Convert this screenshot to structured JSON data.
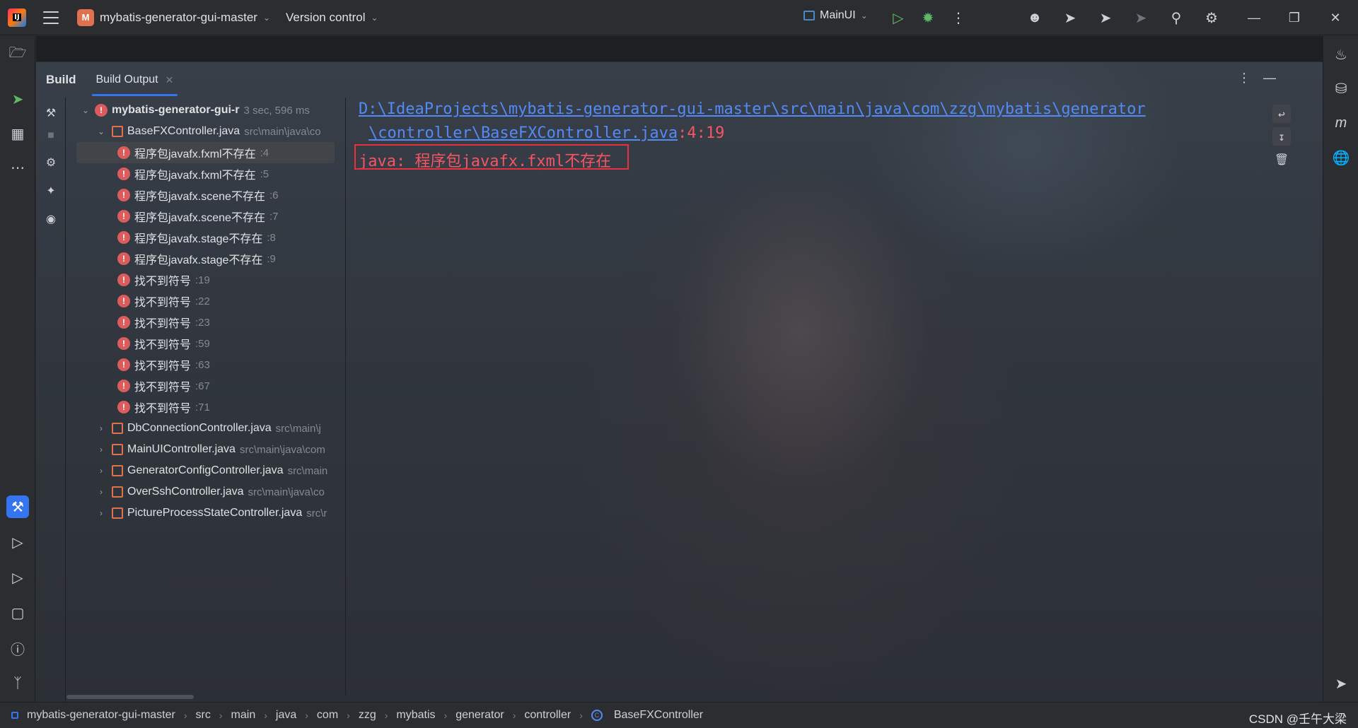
{
  "titlebar": {
    "project_badge": "M",
    "project_name": "mybatis-generator-gui-master",
    "version_control": "Version control",
    "run_config": "MainUI"
  },
  "build_window": {
    "title": "Build",
    "tab_label": "Build Output"
  },
  "tree": {
    "root": {
      "label": "mybatis-generator-gui-r",
      "meta": "3 sec, 596 ms"
    },
    "expanded_file": {
      "label": "BaseFXController.java",
      "path": "src\\main\\java\\co"
    },
    "errors": [
      {
        "label": "程序包javafx.fxml不存在",
        "line": ":4"
      },
      {
        "label": "程序包javafx.fxml不存在",
        "line": ":5"
      },
      {
        "label": "程序包javafx.scene不存在",
        "line": ":6"
      },
      {
        "label": "程序包javafx.scene不存在",
        "line": ":7"
      },
      {
        "label": "程序包javafx.stage不存在",
        "line": ":8"
      },
      {
        "label": "程序包javafx.stage不存在",
        "line": ":9"
      },
      {
        "label": "找不到符号",
        "line": ":19"
      },
      {
        "label": "找不到符号",
        "line": ":22"
      },
      {
        "label": "找不到符号",
        "line": ":23"
      },
      {
        "label": "找不到符号",
        "line": ":59"
      },
      {
        "label": "找不到符号",
        "line": ":63"
      },
      {
        "label": "找不到符号",
        "line": ":67"
      },
      {
        "label": "找不到符号",
        "line": ":71"
      }
    ],
    "collapsed_files": [
      {
        "label": "DbConnectionController.java",
        "path": "src\\main\\j"
      },
      {
        "label": "MainUIController.java",
        "path": "src\\main\\java\\com"
      },
      {
        "label": "GeneratorConfigController.java",
        "path": "src\\main"
      },
      {
        "label": "OverSshController.java",
        "path": "src\\main\\java\\co"
      },
      {
        "label": "PictureProcessStateController.java",
        "path": "src\\r"
      }
    ]
  },
  "console": {
    "link_line1": "D:\\IdeaProjects\\mybatis-generator-gui-master\\src\\main\\java\\com\\zzg\\mybatis\\generator",
    "link_line2": "\\controller\\BaseFXController.java",
    "position": ":4:19",
    "error_message": "java: 程序包javafx.fxml不存在"
  },
  "statusbar": {
    "breadcrumbs": [
      "mybatis-generator-gui-master",
      "src",
      "main",
      "java",
      "com",
      "zzg",
      "mybatis",
      "generator",
      "controller",
      "BaseFXController"
    ],
    "watermark": "CSDN @壬午大梁"
  }
}
